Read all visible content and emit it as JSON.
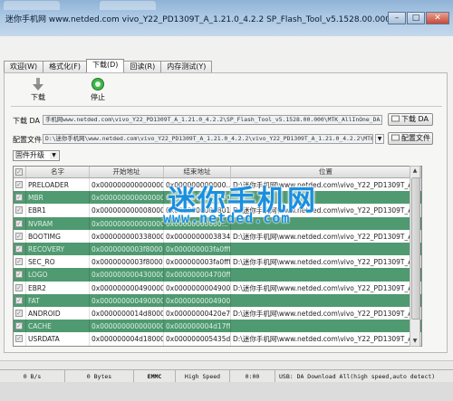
{
  "window": {
    "title": "迷你手机网 www.netded.com   vivo_Y22_PD1309T_A_1.21.0_4.2.2   SP_Flash_Tool_v5.1528.00.000",
    "browser_tabs": [
      "",
      ""
    ]
  },
  "tabs": [
    "欢迎(W)",
    "格式化(F)",
    "下载(D)",
    "回读(R)",
    "内存测试(Y)"
  ],
  "toolbar": {
    "download_label": "下载",
    "stop_label": "停止"
  },
  "download_agent": {
    "label": "下载 DA",
    "path": "手机网www.netded.com\\vivo_Y22_PD1309T_A_1.21.0_4.2.2\\SP_Flash_Tool_v5.1528.00.000\\MTK_AllInOne_DA.bin",
    "button": "下载 DA"
  },
  "scatter": {
    "label": "配置文件",
    "path": "D:\\迷你手机网\\www.netded.com\\vivo_Y22_PD1309T_A_1.21.0_4.2.2\\vivo_Y22_PD1309T_A_1.21.0_4.2.2\\MT6582_",
    "button": "配置文件"
  },
  "mode_select": {
    "value": "固件升级"
  },
  "table": {
    "headers": [
      "",
      "名字",
      "开始地址",
      "结束地址",
      "位置"
    ],
    "rows": [
      {
        "name": "PRELOADER",
        "start": "0x0000000000000000",
        "end": "0x000000000000...",
        "location": "D:\\迷你手机网\\www.netded.com\\vivo_Y22_PD1309T_A_1.21...",
        "style": "w"
      },
      {
        "name": "MBR",
        "start": "0x0000000000000000",
        "end": "0x0000000000000...",
        "location": "",
        "style": "g"
      },
      {
        "name": "EBR1",
        "start": "0x0000000000080000",
        "end": "0x0000000000801ff",
        "location": "D:\\迷你手机网\\www.netded.com\\vivo_Y22_PD1309T_A_1.21...",
        "style": "w"
      },
      {
        "name": "NVRAM",
        "start": "0x0000000000000000",
        "end": "0x00000000000...",
        "location": "",
        "style": "g"
      },
      {
        "name": "BOOTIMG",
        "start": "0x0000000003380000",
        "end": "0x0000000003834ff",
        "location": "D:\\迷你手机网\\www.netded.com\\vivo_Y22_PD1309T_A_1.21...",
        "style": "w"
      },
      {
        "name": "RECOVERY",
        "start": "0x0000000003f80000",
        "end": "0x000000003fa0fff",
        "location": "",
        "style": "g"
      },
      {
        "name": "SEC_RO",
        "start": "0x0000000003f80000",
        "end": "0x000000003fa0fff",
        "location": "D:\\迷你手机网\\www.netded.com\\vivo_Y22_PD1309T_A_1.21...",
        "style": "w"
      },
      {
        "name": "LOGO",
        "start": "0x0000000004300000",
        "end": "0x000000004700fff",
        "location": "",
        "style": "g"
      },
      {
        "name": "EBR2",
        "start": "0x0000000004900000",
        "end": "0x00000000049001ff",
        "location": "D:\\迷你手机网\\www.netded.com\\vivo_Y22_PD1309T_A_1.21...",
        "style": "w"
      },
      {
        "name": "FAT",
        "start": "0x0000000004900000",
        "end": "0x00000000049001ff",
        "location": "",
        "style": "g"
      },
      {
        "name": "ANDROID",
        "start": "0x0000000014d80000",
        "end": "0x00000000420e7d07",
        "location": "D:\\迷你手机网\\www.netded.com\\vivo_Y22_PD1309T_A_1.21...",
        "style": "w"
      },
      {
        "name": "CACHE",
        "start": "0x0000000000000000",
        "end": "0x000000004d17ffff",
        "location": "",
        "style": "g"
      },
      {
        "name": "USRDATA",
        "start": "0x000000004d180000",
        "end": "0x000000005435d25b",
        "location": "D:\\迷你手机网\\www.netded.com\\vivo_Y22_PD1309T_A_1.21...",
        "style": "w"
      }
    ]
  },
  "watermark": {
    "main": "迷你手机网",
    "url": "www.netded.com"
  },
  "status": {
    "speed": "0 B/s",
    "bytes": "0 Bytes",
    "storage": "EMMC",
    "mode": "High Speed",
    "time": "0:00",
    "info": "USB: DA Download All(high speed,auto detect)"
  },
  "colors": {
    "green_row": "#4f9a70",
    "watermark": "#1a8fe0"
  }
}
